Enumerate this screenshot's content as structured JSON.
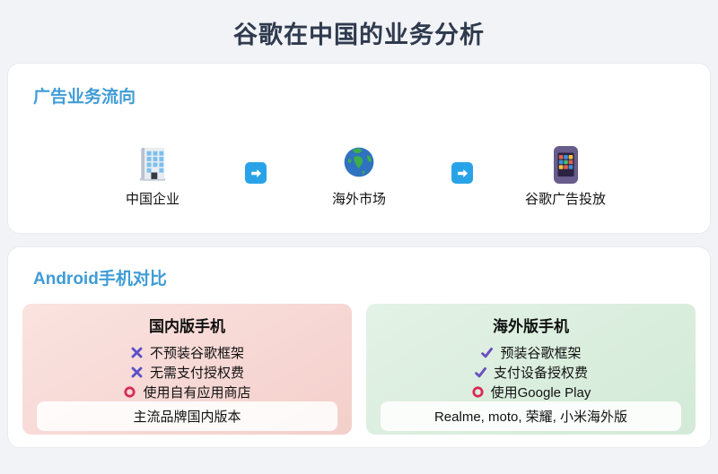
{
  "page": {
    "title": "谷歌在中国的业务分析",
    "background_color": "#f1f3f7",
    "title_color": "#2f3a4e",
    "heading_accent_color": "#3f9cd6"
  },
  "ad_flow": {
    "heading": "广告业务流向",
    "steps": [
      {
        "icon": "office-building-icon",
        "label": "中国企业"
      },
      {
        "icon": "globe-icon",
        "label": "海外市场"
      },
      {
        "icon": "mobile-phone-apps-icon",
        "label": "谷歌广告投放"
      }
    ],
    "arrow": {
      "icon": "right-arrow-icon",
      "color": "#29a3e8"
    }
  },
  "android_comparison": {
    "heading": "Android手机对比",
    "panels": [
      {
        "id": "domestic",
        "title": "国内版手机",
        "background_color": "#f6d4d1",
        "items": [
          {
            "marker": "cross",
            "text": "不预装谷歌框架"
          },
          {
            "marker": "cross",
            "text": "无需支付授权费"
          },
          {
            "marker": "circle",
            "text": "使用自有应用商店"
          }
        ],
        "footer": "主流品牌国内版本"
      },
      {
        "id": "overseas",
        "title": "海外版手机",
        "background_color": "#d8ecdb",
        "items": [
          {
            "marker": "check",
            "text": "预装谷歌框架"
          },
          {
            "marker": "check",
            "text": "支付设备授权费"
          },
          {
            "marker": "circle",
            "text": "使用Google Play"
          }
        ],
        "footer": "Realme, moto, 荣耀, 小米海外版"
      }
    ],
    "marker_colors": {
      "cross": "#5b51c9",
      "check": "#6a4fc0",
      "circle": "#d92b55"
    }
  }
}
